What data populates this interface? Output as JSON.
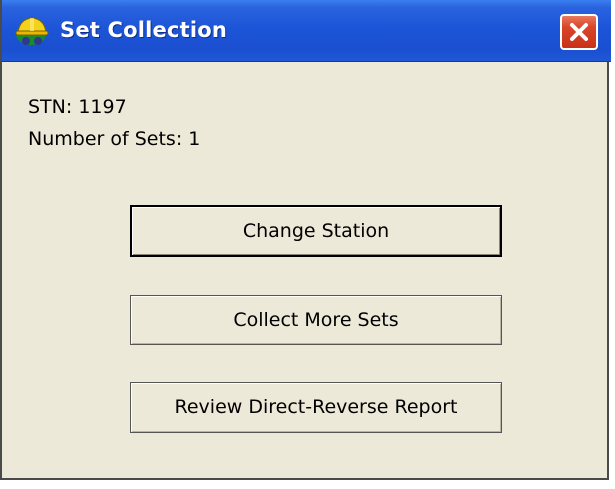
{
  "window": {
    "title": "Set Collection",
    "title_icon": "surveyor-hardhat-icon",
    "close_icon": "close-icon"
  },
  "info": {
    "station_line": "STN: 1197",
    "sets_line": "Number of Sets: 1"
  },
  "buttons": {
    "change_station": "Change Station",
    "collect_more_sets": "Collect More Sets",
    "review_report": "Review Direct-Reverse Report"
  },
  "colors": {
    "titlebar": "#1d55d8",
    "close_button": "#c8321a",
    "dialog_background": "#ece9d8"
  }
}
